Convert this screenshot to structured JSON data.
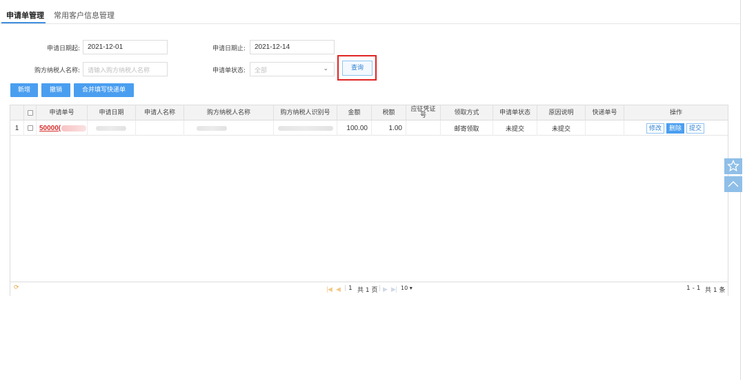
{
  "tabs": [
    {
      "label": "申请单管理",
      "active": true
    },
    {
      "label": "常用客户信息管理",
      "active": false
    }
  ],
  "form": {
    "date_start_label": "申请日期起:",
    "date_start_value": "2021-12-01",
    "date_end_label": "申请日期止:",
    "date_end_value": "2021-12-14",
    "buyer_name_label": "购方纳税人名称:",
    "buyer_name_placeholder": "请输入购方纳税人名称",
    "status_label": "申请单状态:",
    "status_value": "全部",
    "query_label": "查询"
  },
  "toolbar": {
    "add_label": "新增",
    "revoke_label": "撤销",
    "merge_label": "合并填写快递单"
  },
  "table": {
    "headers": [
      "申请单号",
      "申请日期",
      "申请人名称",
      "购方纳税人名称",
      "购方纳税人识别号",
      "金额",
      "税额",
      "应征凭证号",
      "领取方式",
      "申请单状态",
      "原因说明",
      "快递单号",
      "操作"
    ],
    "rows": [
      {
        "index": "1",
        "app_no": "50000(",
        "amount": "100.00",
        "tax": "1.00",
        "pickup": "邮寄领取",
        "status": "未提交",
        "reason": "未提交",
        "actions": [
          "修改",
          "删除",
          "提交"
        ]
      }
    ]
  },
  "pager": {
    "page": "1",
    "total_pages": "共 1 页",
    "page_size": "10 ▾",
    "range": "1 - 1",
    "total_items": "共 1 条"
  },
  "colors": {
    "accent": "#4a9ef0",
    "highlight_border": "#e02424",
    "link_red": "#d42d2d"
  }
}
